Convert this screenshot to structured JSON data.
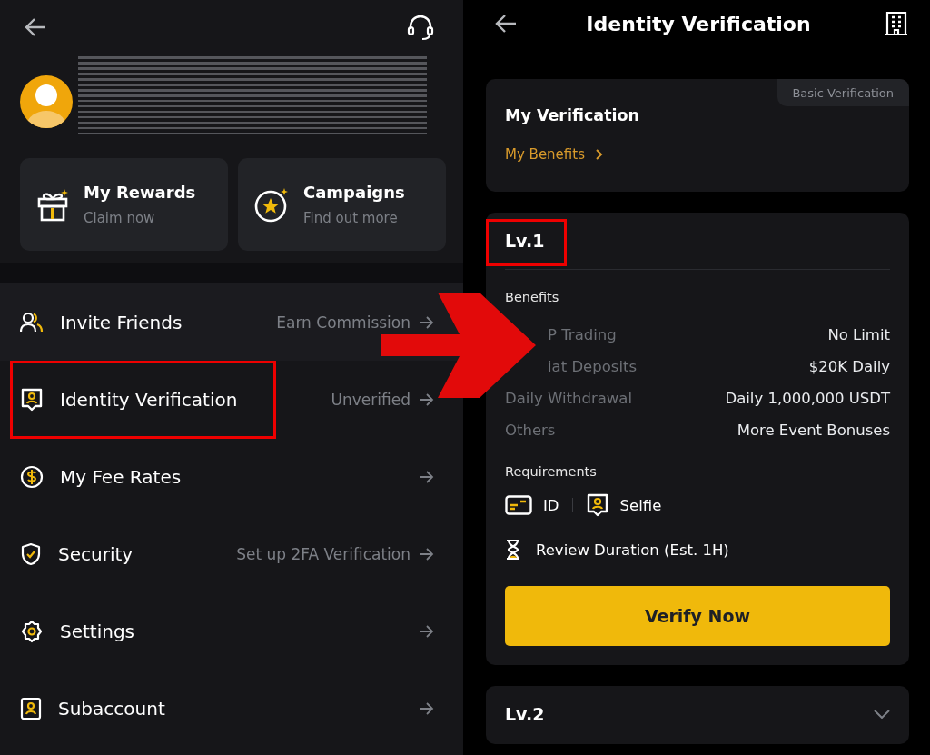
{
  "left_panel": {
    "cards": [
      {
        "title": "My Rewards",
        "subtitle": "Claim now"
      },
      {
        "title": "Campaigns",
        "subtitle": "Find out more"
      }
    ],
    "menu": [
      {
        "label": "Invite Friends",
        "value": "Earn Commission",
        "highlighted": false
      },
      {
        "label": "Identity Verification",
        "value": "Unverified",
        "highlighted": true
      },
      {
        "label": "My Fee Rates",
        "highlighted": false
      },
      {
        "label": "Security",
        "value": "Set up 2FA Verification",
        "highlighted": false
      },
      {
        "label": "Settings",
        "highlighted": false
      },
      {
        "label": "Subaccount",
        "highlighted": false
      }
    ]
  },
  "right_panel": {
    "title": "Identity Verification",
    "summary": {
      "title": "My Verification",
      "badge": "Basic Verification",
      "link": "My Benefits"
    },
    "levels": [
      {
        "title": "Lv.1",
        "expanded": true,
        "highlighted": true,
        "benefits_label": "Benefits",
        "benefits": [
          {
            "name": "P Trading",
            "value": "No Limit",
            "covered": true
          },
          {
            "name": "iat Deposits",
            "value": "$20K Daily",
            "covered": true
          },
          {
            "name": "Daily Withdrawal",
            "value": "Daily 1,000,000 USDT",
            "covered": false
          },
          {
            "name": "Others",
            "value": "More Event Bonuses",
            "covered": false
          }
        ],
        "requirements_label": "Requirements",
        "requirements": [
          "ID",
          "Selfie"
        ],
        "review": "Review Duration (Est. 1H)",
        "button": "Verify Now"
      },
      {
        "title": "Lv.2",
        "expanded": false,
        "highlighted": false
      }
    ]
  }
}
